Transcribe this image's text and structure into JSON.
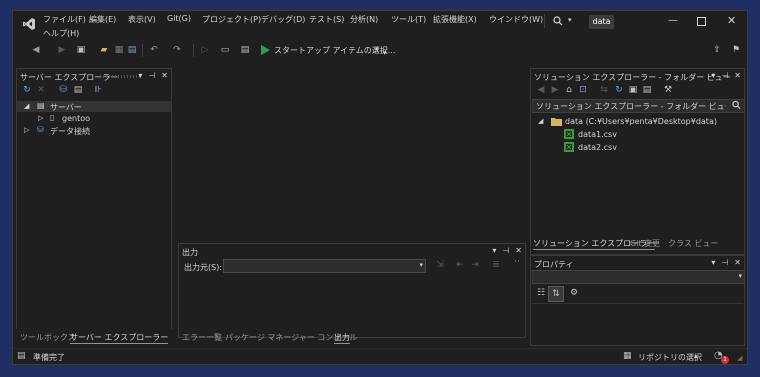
{
  "menu": {
    "items": [
      "ファイル(F)",
      "編集(E)",
      "表示(V)",
      "Git(G)",
      "プロジェクト(P)",
      "デバッグ(D)",
      "テスト(S)",
      "分析(N)",
      "ツール(T)",
      "拡張機能(X)",
      "ウインドウ(W)"
    ],
    "help": "ヘルプ(H)"
  },
  "title_badge": "data",
  "toolbar": {
    "start_label": "スタートアップ アイテムの選択..."
  },
  "server_explorer": {
    "title": "サーバー エクスプローラー",
    "root": "サーバー",
    "child": "gentoo",
    "data_connections": "データ接続"
  },
  "output": {
    "title": "出力",
    "source_label": "出力元(S):"
  },
  "solution_explorer": {
    "title": "ソリューション エクスプローラー - フォルダー ビュー",
    "search_placeholder": "ソリューション エクスプローラー - フォルダー ビュー の検索 (Ctrl+;)",
    "folder": "data (C:¥Users¥penta¥Desktop¥data)",
    "files": [
      "data1.csv",
      "data2.csv"
    ]
  },
  "right_tabs": [
    "ソリューション エクスプローラー",
    "Git 変更",
    "クラス ビュー"
  ],
  "properties": {
    "title": "プロパティ"
  },
  "left_tabs": [
    "ツールボックス",
    "サーバー エクスプローラー"
  ],
  "bottom_tabs": [
    "エラー一覧",
    "パッケージ マネージャー コンソール",
    "出力"
  ],
  "status": {
    "ready": "準備完了",
    "repo": "リポジトリの選択",
    "notification_count": "1"
  },
  "colors": {
    "accent": "#0e639c",
    "play": "#2ea043",
    "csv": "#3a9a3a",
    "folder": "#d8b45a",
    "badge": "#d32f2f"
  }
}
